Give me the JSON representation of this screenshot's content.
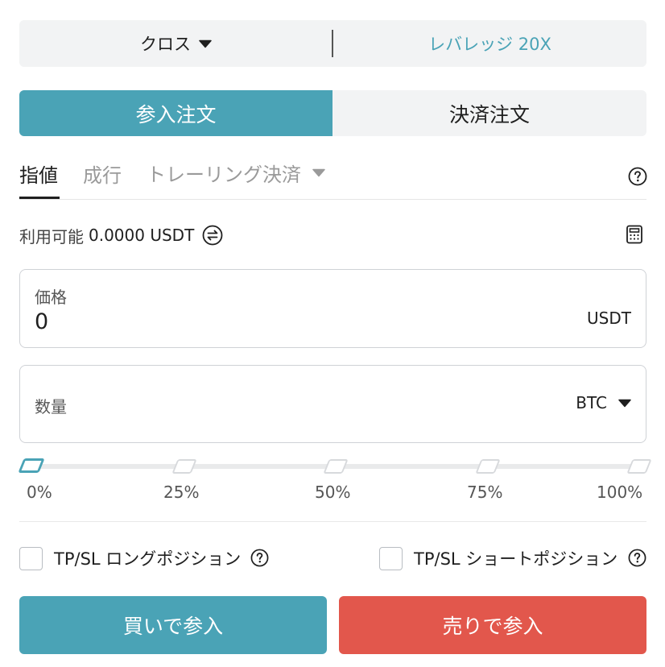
{
  "colors": {
    "accent": "#4aa3b6",
    "sell": "#e2574c",
    "muted_tab": "#9a9a9a",
    "panel_bg": "#f2f3f4"
  },
  "mode_bar": {
    "margin_mode": "クロス",
    "margin_mode_icon": "caret-down-icon",
    "leverage": "レバレッジ 20X"
  },
  "side_tabs": {
    "open_label": "参入注文",
    "close_label": "決済注文",
    "active": "open"
  },
  "order_types": {
    "limit": "指値",
    "market": "成行",
    "trailing": "トレーリング決済",
    "active": "limit",
    "help_icon": "question-circle-icon"
  },
  "available": {
    "label": "利用可能",
    "value": "0.0000 USDT",
    "transfer_icon": "transfer-icon",
    "calculator_icon": "calculator-icon"
  },
  "price": {
    "label": "価格",
    "value": "0",
    "unit": "USDT"
  },
  "quantity": {
    "label": "数量",
    "value": "",
    "unit": "BTC"
  },
  "slider": {
    "value_percent": 0,
    "marks": [
      "0%",
      "25%",
      "50%",
      "75%",
      "100%"
    ]
  },
  "tpsl": {
    "long_label": "TP/SL ロングポジション",
    "short_label": "TP/SL ショートポジション",
    "long_checked": false,
    "short_checked": false
  },
  "actions": {
    "buy_label": "買いで参入",
    "sell_label": "売りで参入"
  }
}
